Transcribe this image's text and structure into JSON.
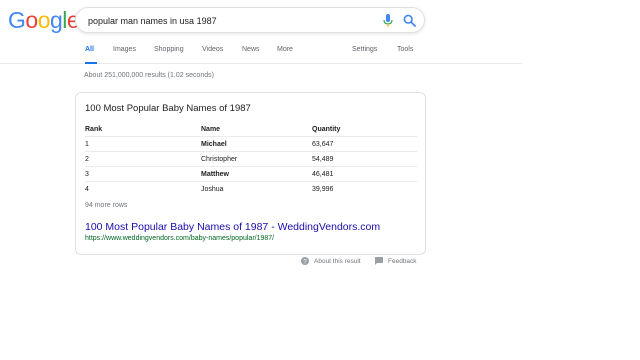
{
  "logo": {
    "letters": [
      "G",
      "o",
      "o",
      "g",
      "l",
      "e"
    ],
    "colors": [
      "#4285f4",
      "#ea4335",
      "#fbbc05",
      "#4285f4",
      "#34a853",
      "#ea4335"
    ]
  },
  "search": {
    "query": "popular man names in usa 1987"
  },
  "tabs": [
    {
      "label": "All",
      "active": true
    },
    {
      "label": "Images"
    },
    {
      "label": "Shopping"
    },
    {
      "label": "Videos"
    },
    {
      "label": "News"
    },
    {
      "label": "More"
    },
    {
      "label": "Settings"
    },
    {
      "label": "Tools"
    }
  ],
  "stats": "About 251,000,000 results (1.02 seconds)",
  "snippet": {
    "title": "100 Most Popular Baby Names of 1987",
    "headers": [
      "Rank",
      "Name",
      "Quantity"
    ],
    "rows": [
      {
        "rank": "1",
        "name": "Michael",
        "quantity": "63,647",
        "bold": true
      },
      {
        "rank": "2",
        "name": "Christopher",
        "quantity": "54,489",
        "bold": false
      },
      {
        "rank": "3",
        "name": "Matthew",
        "quantity": "46,481",
        "bold": true
      },
      {
        "rank": "4",
        "name": "Joshua",
        "quantity": "39,996",
        "bold": false
      }
    ],
    "more_rows": "94 more rows",
    "result_title": "100 Most Popular Baby Names of 1987 - WeddingVendors.com",
    "result_url": "https://www.weddingvendors.com/baby-names/popular/1987/"
  },
  "footer": {
    "about": "About this result",
    "feedback": "Feedback"
  },
  "colors": {
    "link": "#1a0dab",
    "url": "#006621",
    "accent": "#1a73e8",
    "muted": "#70757a"
  }
}
